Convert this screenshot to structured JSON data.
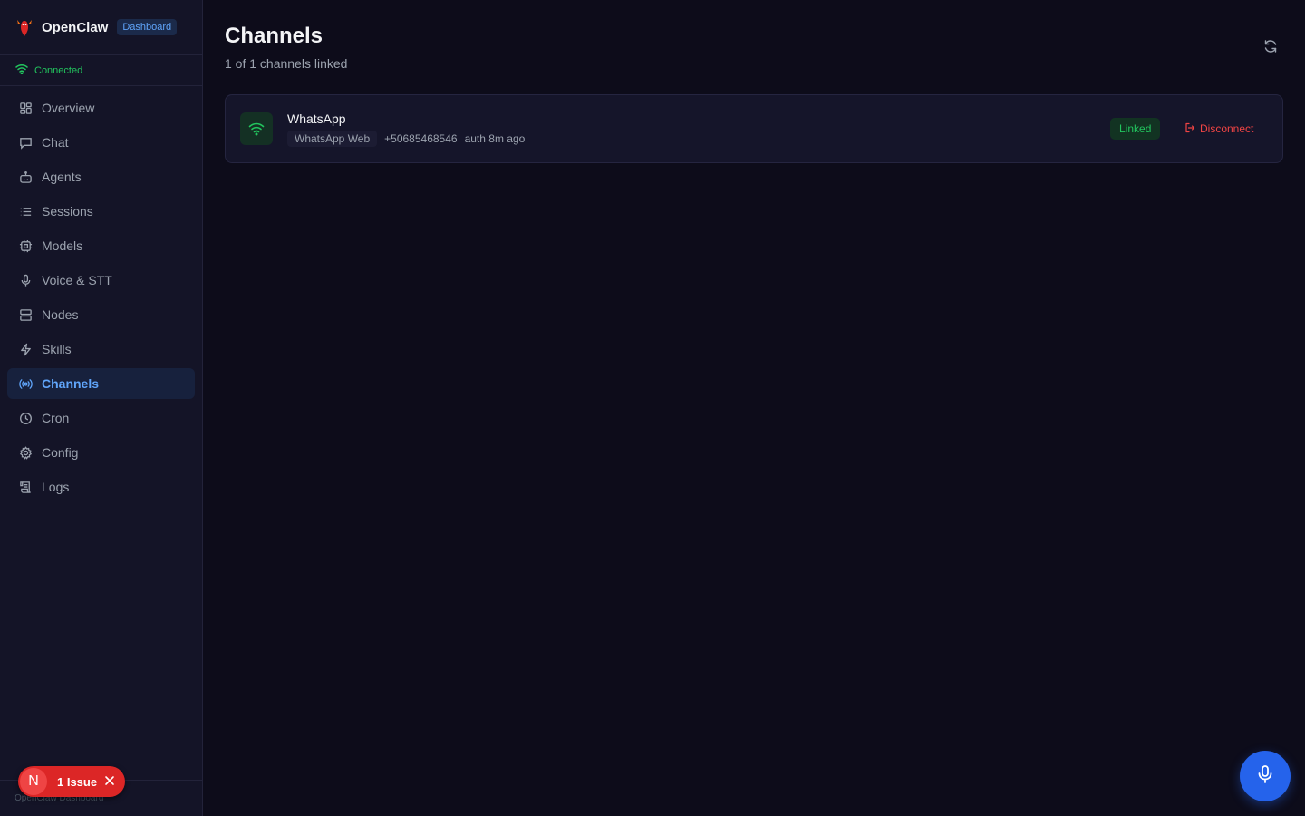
{
  "brand": {
    "name": "OpenClaw",
    "badge": "Dashboard",
    "logo_icon": "lobster-icon"
  },
  "connection": {
    "status": "Connected",
    "color": "#22c55e"
  },
  "sidebar": {
    "items": [
      {
        "label": "Overview",
        "icon": "grid-icon"
      },
      {
        "label": "Chat",
        "icon": "chat-icon"
      },
      {
        "label": "Agents",
        "icon": "bot-icon"
      },
      {
        "label": "Sessions",
        "icon": "list-icon"
      },
      {
        "label": "Models",
        "icon": "cpu-icon"
      },
      {
        "label": "Voice & STT",
        "icon": "mic-icon"
      },
      {
        "label": "Nodes",
        "icon": "server-icon"
      },
      {
        "label": "Skills",
        "icon": "bolt-icon"
      },
      {
        "label": "Channels",
        "icon": "radio-icon",
        "active": true
      },
      {
        "label": "Cron",
        "icon": "clock-icon"
      },
      {
        "label": "Config",
        "icon": "gear-icon"
      },
      {
        "label": "Logs",
        "icon": "scroll-icon"
      }
    ],
    "footer": "OpenClaw Dashboard"
  },
  "issue": {
    "avatar_letter": "N",
    "label": "1 Issue"
  },
  "page": {
    "title": "Channels",
    "subtitle": "1 of 1 channels linked"
  },
  "channels": [
    {
      "name": "WhatsApp",
      "type": "WhatsApp Web",
      "phone": "+50685468546",
      "auth": "auth 8m ago",
      "status": "Linked",
      "action": "Disconnect"
    }
  ],
  "colors": {
    "accent": "#60a5fa",
    "linked": "#22c55e",
    "danger": "#ef4444",
    "mic": "#2563eb"
  }
}
